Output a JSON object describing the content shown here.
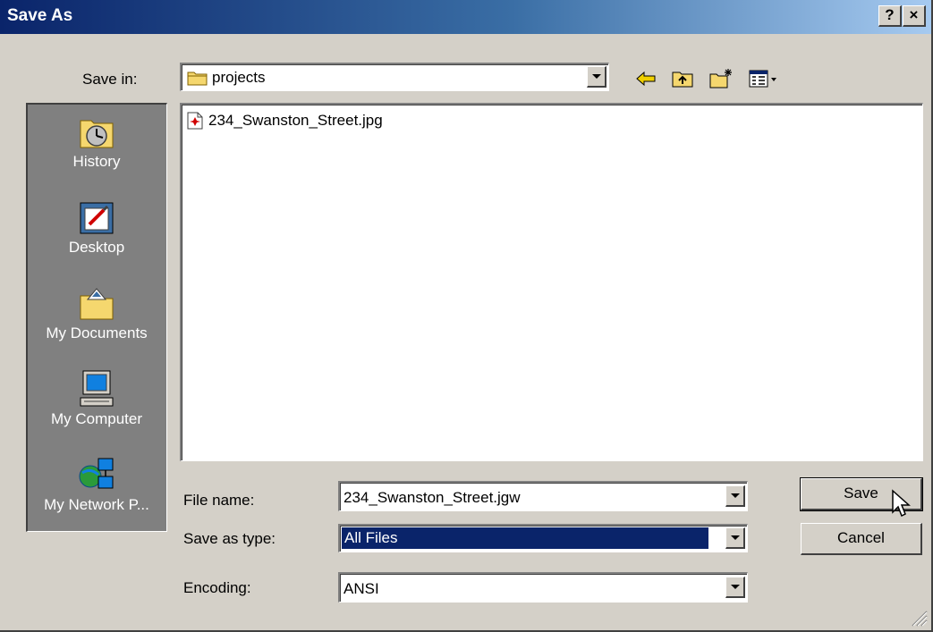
{
  "window": {
    "title": "Save As",
    "help_glyph": "?",
    "close_glyph": "×"
  },
  "toolbar": {
    "save_in_label": "Save in:",
    "save_in_value": "projects",
    "icons": [
      "back-arrow-icon",
      "up-one-level-icon",
      "new-folder-icon",
      "views-menu-icon"
    ]
  },
  "places": [
    {
      "label": "History",
      "icon": "history-icon"
    },
    {
      "label": "Desktop",
      "icon": "desktop-icon"
    },
    {
      "label": "My Documents",
      "icon": "my-documents-icon"
    },
    {
      "label": "My Computer",
      "icon": "my-computer-icon"
    },
    {
      "label": "My Network P...",
      "icon": "my-network-places-icon"
    }
  ],
  "files": [
    {
      "name": "234_Swanston_Street.jpg",
      "icon": "jpg-file-icon"
    }
  ],
  "form": {
    "file_name_label": "File name:",
    "file_name_value": "234_Swanston_Street.jgw",
    "save_as_type_label": "Save as type:",
    "save_as_type_value": "All Files",
    "encoding_label": "Encoding:",
    "encoding_value": "ANSI"
  },
  "buttons": {
    "save": "Save",
    "cancel": "Cancel"
  },
  "colors": {
    "title_bar_start": "#0a246a",
    "title_bar_end": "#a6caf0",
    "dialog_face": "#d4d0c8",
    "places_bar": "#808080",
    "selection": "#0a246a"
  }
}
